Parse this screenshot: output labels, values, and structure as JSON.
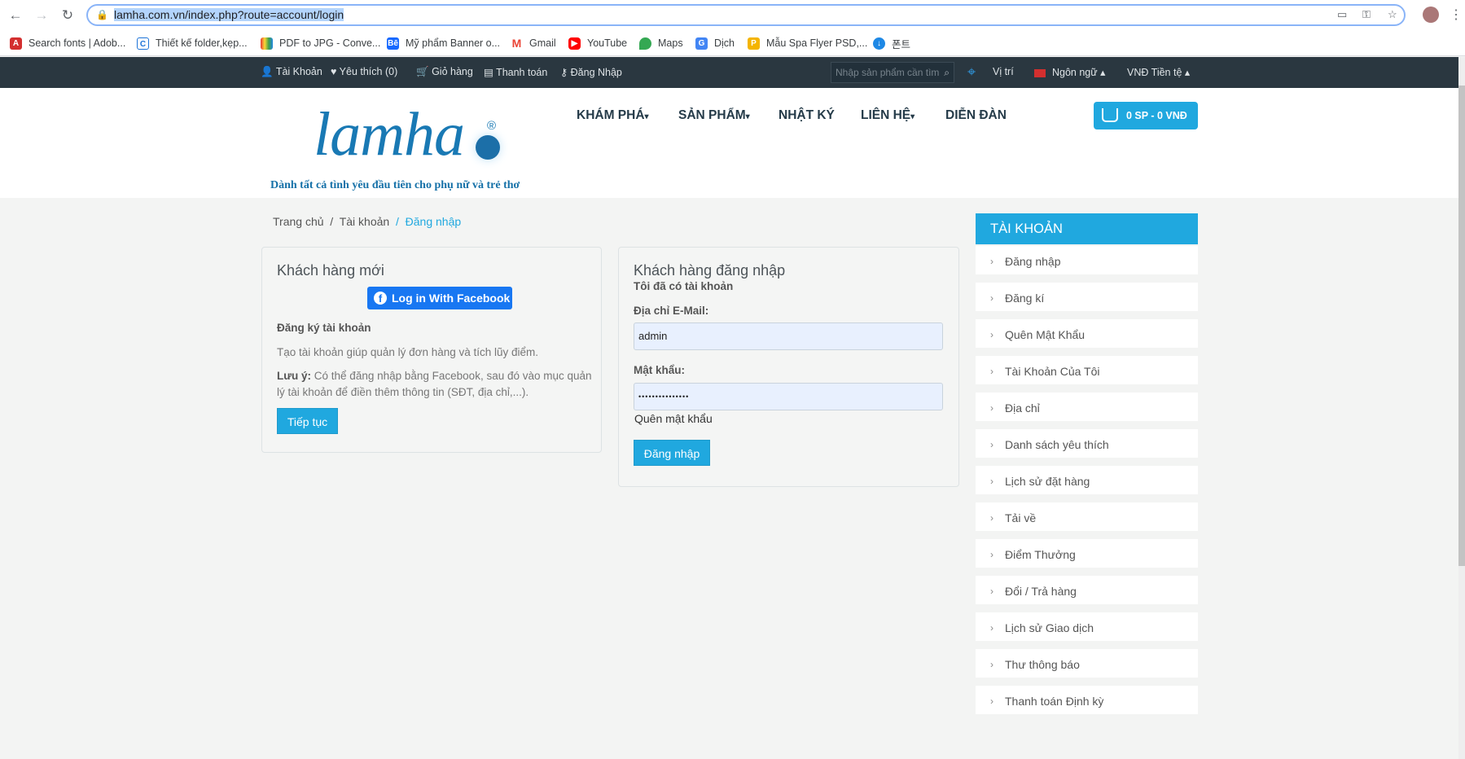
{
  "browser": {
    "url_selected": "lamha.com.vn/index.php?route=account/login",
    "bookmarks": [
      "Search fonts | Adob...",
      "Thiết kế folder,kẹp...",
      "PDF to JPG - Conve...",
      "Mỹ phẩm Banner o...",
      "Gmail",
      "YouTube",
      "Maps",
      "Dịch",
      "Mẫu Spa Flyer PSD,...",
      "폰트"
    ]
  },
  "topbar": {
    "account": "Tài Khoản",
    "wishlist": "Yêu thích (0)",
    "cart": "Giỏ hàng",
    "checkout": "Thanh toán",
    "login": "Đăng Nhập",
    "search_placeholder": "Nhập sản phẩm cần tìm",
    "location": "Vị trí",
    "language": "Ngôn ngữ",
    "currency_code": "VNĐ",
    "currency": "Tiền tệ"
  },
  "header": {
    "logo_text": "lamha",
    "logo_reg": "®",
    "tagline": "Dành tất cả tình yêu đầu tiên cho phụ nữ và trẻ thơ",
    "menu": [
      "KHÁM PHÁ",
      "SẢN PHẨM",
      "NHẬT KÝ",
      "LIÊN HỆ",
      "DIỄN ĐÀN"
    ],
    "cart_label": "0 SP - 0 VNĐ"
  },
  "breadcrumb": [
    "Trang chủ",
    "Tài khoản",
    "Đăng nhập"
  ],
  "new_customer": {
    "title": "Khách hàng mới",
    "facebook_button": "Log in With Facebook",
    "register_heading": "Đăng ký tài khoản",
    "description": "Tạo tài khoản giúp quản lý đơn hàng và tích lũy điểm.",
    "note_label": "Lưu ý:",
    "note_text": " Có thể đăng nhập bằng Facebook, sau đó vào mục quản lý tài khoản để điền thêm thông tin (SĐT, địa chỉ,...).",
    "continue_button": "Tiếp tục"
  },
  "login": {
    "title": "Khách hàng đăng nhập",
    "subtitle": "Tôi đã có tài khoản",
    "email_label": "Địa chỉ E-Mail:",
    "email_value": "admin",
    "password_label": "Mật khẩu:",
    "password_value": "•••••••••••••••",
    "forgot_link": "Quên mật khẩu",
    "submit_button": "Đăng nhập"
  },
  "sidebar": {
    "title": "TÀI KHOẢN",
    "items": [
      "Đăng nhập",
      "Đăng kí",
      "Quên Mật Khẩu",
      "Tài Khoản Của Tôi",
      "Địa chỉ",
      "Danh sách yêu thích",
      "Lịch sử đặt hàng",
      "Tải về",
      "Điểm Thưởng",
      "Đổi / Trả hàng",
      "Lịch sử Giao dịch",
      "Thư thông báo",
      "Thanh toán Định kỳ"
    ]
  },
  "colors": {
    "accent": "#20a8df",
    "topbar": "#2a3740",
    "facebook": "#1877f2"
  }
}
